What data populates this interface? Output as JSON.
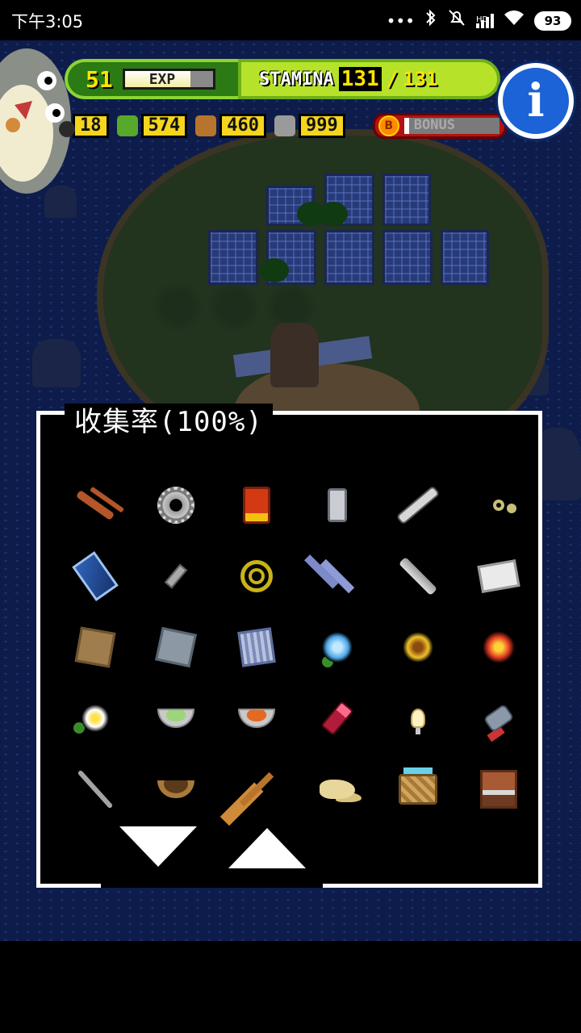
{
  "status_bar": {
    "time": "下午3:05",
    "dots": "•••",
    "bluetooth_icon": "bluetooth-icon",
    "mute_icon": "ringer-off-icon",
    "signal_label": "HD",
    "wifi_icon": "wifi-icon",
    "battery": "93"
  },
  "hud": {
    "level": "51",
    "exp_label": "EXP",
    "exp_fill_percent": 75,
    "stamina_label": "STAMINA",
    "stamina_current": "131",
    "stamina_separator": "/",
    "stamina_max": "131",
    "resources": [
      {
        "icon": "partial-counter-icon",
        "value": "18",
        "color": "#f5d51d"
      },
      {
        "icon": "herb-icon",
        "value": "574",
        "color": "#58a82a"
      },
      {
        "icon": "nut-icon",
        "value": "460",
        "color": "#b8742a"
      },
      {
        "icon": "stone-icon",
        "value": "999",
        "color": "#9a9a9a"
      }
    ],
    "bonus_coin": "B",
    "bonus_label": "BONUS",
    "bonus_fill_percent": 5,
    "info_button": "i"
  },
  "collection": {
    "title": "收集率(100%)",
    "items": [
      {
        "icon": "branch-icon",
        "sprite": "it-branch"
      },
      {
        "icon": "gear-icon",
        "sprite": "it-gear"
      },
      {
        "icon": "oil-can-icon",
        "sprite": "it-can"
      },
      {
        "icon": "glass-jar-icon",
        "sprite": "it-jar"
      },
      {
        "icon": "spark-plug-icon",
        "sprite": "it-plug"
      },
      {
        "icon": "keys-icon",
        "sprite": "it-keys"
      },
      {
        "icon": "smartphone-icon",
        "sprite": "it-phone"
      },
      {
        "icon": "battery-icon",
        "sprite": "it-battery"
      },
      {
        "icon": "rope-icon",
        "sprite": "it-rope"
      },
      {
        "icon": "hammer-icon",
        "sprite": "it-hammer"
      },
      {
        "icon": "pipe-icon",
        "sprite": "it-pipe"
      },
      {
        "icon": "book-icon",
        "sprite": "it-book"
      },
      {
        "icon": "map-paper-icon",
        "sprite": "it-paper"
      },
      {
        "icon": "gray-cloth-icon",
        "sprite": "it-cloth"
      },
      {
        "icon": "striped-cloth-icon",
        "sprite": "it-cloth2"
      },
      {
        "icon": "blue-flower-icon",
        "sprite": "it-flower-blue"
      },
      {
        "icon": "yellow-flower-icon",
        "sprite": "it-flower-yel"
      },
      {
        "icon": "red-flower-icon",
        "sprite": "it-flower-red"
      },
      {
        "icon": "white-flower-icon",
        "sprite": "it-flower-wht"
      },
      {
        "icon": "green-soup-bowl-icon",
        "sprite": "it-bowl-green"
      },
      {
        "icon": "orange-soup-bowl-icon",
        "sprite": "it-bowl-orange"
      },
      {
        "icon": "lipstick-icon",
        "sprite": "it-lipstick"
      },
      {
        "icon": "light-bulb-icon",
        "sprite": "it-bulb"
      },
      {
        "icon": "electric-shaver-icon",
        "sprite": "it-shaver"
      },
      {
        "icon": "stick-icon",
        "sprite": "it-stick"
      },
      {
        "icon": "coconut-bowl-icon",
        "sprite": "it-coconut"
      },
      {
        "icon": "wooden-spoon-icon",
        "sprite": "it-broom"
      },
      {
        "icon": "cheese-blob-icon",
        "sprite": "it-blob"
      },
      {
        "icon": "basket-icon",
        "sprite": "it-basket"
      },
      {
        "icon": "cabinet-icon",
        "sprite": "it-cabinet"
      }
    ],
    "page_down_icon": "triangle-down-icon",
    "page_up_icon": "triangle-up-icon"
  },
  "colors": {
    "ocean": "#0d1c4a",
    "panel_bg": "#000000",
    "panel_border": "#ffffff",
    "level_green": "#2c7a14",
    "stamina_lime": "#b6e22a",
    "resource_yellow": "#f5d51d",
    "bonus_red": "#b31212",
    "info_blue": "#1b63d6"
  }
}
